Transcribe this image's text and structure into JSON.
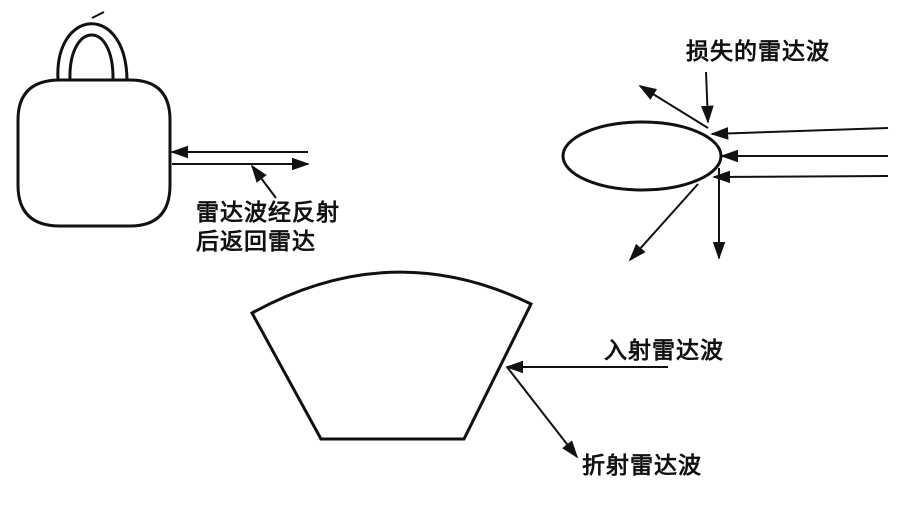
{
  "labels": {
    "lost_wave": "损失的雷达波",
    "reflected_line1": "雷达波经反射",
    "reflected_line2": "后返回雷达",
    "incident_wave": "入射雷达波",
    "refracted_wave": "折射雷达波"
  },
  "colors": {
    "stroke": "#111111",
    "background": "#ffffff"
  }
}
